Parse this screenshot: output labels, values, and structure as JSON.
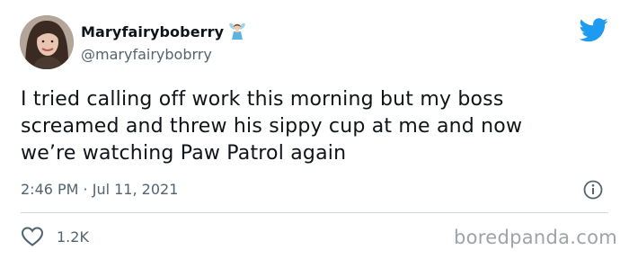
{
  "tweet": {
    "display_name": "Maryfairyboberry",
    "handle": "@maryfairybobrry",
    "text_lines": [
      "I tried calling off work this morning but my boss",
      "screamed and threw his sippy cup at me and now",
      "we’re watching Paw Patrol again"
    ],
    "timestamp": "2:46 PM · Jul 11, 2021",
    "like_count": "1.2K"
  },
  "icons": {
    "avatar": "user-avatar-photo",
    "name_emoji": "fairy-emoji",
    "logo": "twitter-bird-icon",
    "info": "info-icon",
    "like": "heart-outline-icon"
  },
  "watermark": "boredpanda.com",
  "colors": {
    "twitter_blue": "#1d9bf0",
    "secondary_text": "#536471",
    "divider": "#cfd9de",
    "watermark": "#9ea3a7"
  }
}
